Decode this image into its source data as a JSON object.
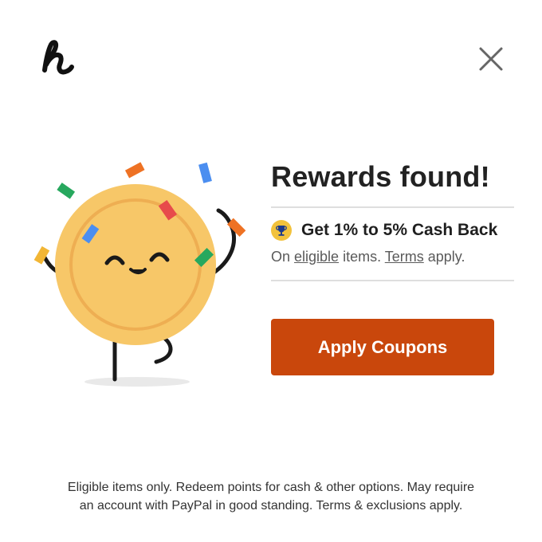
{
  "header": {
    "logo_icon": "honey-h-logo-icon",
    "close_icon": "close-icon"
  },
  "main": {
    "title": "Rewards found!",
    "cashback": {
      "icon": "trophy-icon",
      "text": "Get 1% to 5% Cash Back"
    },
    "sub": {
      "prefix": "On ",
      "eligible_link": "eligible",
      "middle": " items. ",
      "terms_link": "Terms",
      "suffix": " apply."
    },
    "apply_button": "Apply Coupons"
  },
  "footer": {
    "line1": "Eligible items only. Redeem points for cash & other options. May require",
    "line2": "an account with PayPal in good standing. Terms & exclusions apply."
  },
  "colors": {
    "accent": "#c9470c",
    "coin": "#f7c768",
    "coin_ring": "#eeae52"
  }
}
